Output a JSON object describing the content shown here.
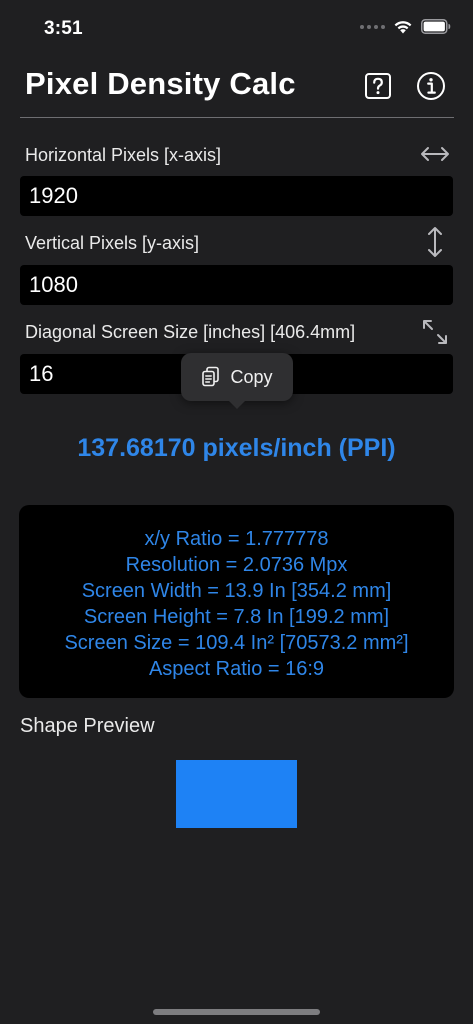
{
  "status_bar": {
    "time": "3:51"
  },
  "header": {
    "title": "Pixel Density Calc",
    "help_icon": "question-mark-square-icon",
    "info_icon": "info-circle-icon"
  },
  "fields": {
    "horizontal": {
      "label": "Horizontal Pixels  [x-axis]",
      "value": "1920",
      "icon": "horizontal-arrows-icon"
    },
    "vertical": {
      "label": "Vertical Pixels [y-axis]",
      "value": "1080",
      "icon": "vertical-arrows-icon"
    },
    "diagonal": {
      "label": "Diagonal Screen Size [inches] [406.4mm]",
      "value": "16",
      "icon": "diagonal-arrows-icon"
    }
  },
  "copy_menu": {
    "label": "Copy",
    "icon": "copy-document-icon"
  },
  "result": {
    "ppi": "137.68170 pixels/inch (PPI)"
  },
  "stats": {
    "ratio": "x/y Ratio = 1.777778",
    "resolution": "Resolution = 2.0736 Mpx",
    "width": "Screen Width = 13.9 In [354.2 mm]",
    "height": "Screen Height = 7.8 In [199.2 mm]",
    "size": "Screen Size = 109.4 In² [70573.2 mm²]",
    "aspect": "Aspect Ratio = 16:9"
  },
  "preview": {
    "label": "Shape Preview"
  },
  "colors": {
    "background": "#1f1f21",
    "accent": "#2f86e8",
    "shape": "#1e82f5",
    "input_bg": "#000000"
  }
}
